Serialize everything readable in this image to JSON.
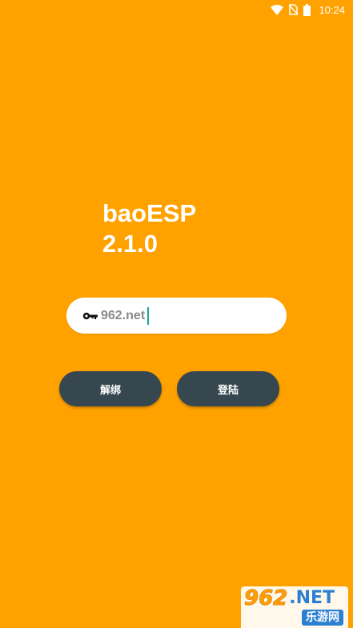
{
  "status_bar": {
    "time": "10:24",
    "icons": [
      "wifi-icon",
      "no-sim-icon",
      "battery-icon"
    ]
  },
  "app": {
    "name": "baoESP",
    "version": "2.1.0"
  },
  "key_field": {
    "icon": "key-icon",
    "value": "962.net"
  },
  "buttons": {
    "unbind_label": "解绑",
    "login_label": "登陆"
  },
  "watermark": {
    "digits": "962",
    "domain": ".NET",
    "sub": "乐游网"
  },
  "colors": {
    "background": "#FFA200",
    "button": "#37474F",
    "caret": "#1BA89C"
  }
}
